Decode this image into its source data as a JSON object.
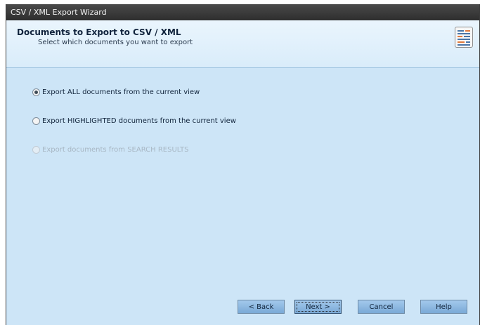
{
  "window": {
    "title": "CSV / XML Export Wizard"
  },
  "header": {
    "title": "Documents to Export to CSV / XML",
    "subtitle": "Select which documents you want to export",
    "icon": "export-document-icon"
  },
  "options": [
    {
      "label": "Export ALL documents from the current view",
      "selected": true,
      "enabled": true
    },
    {
      "label": "Export HIGHLIGHTED documents from the current view",
      "selected": false,
      "enabled": true
    },
    {
      "label": "Export documents from SEARCH RESULTS",
      "selected": false,
      "enabled": false
    }
  ],
  "buttons": {
    "back": "< Back",
    "next": "Next >",
    "cancel": "Cancel",
    "help": "Help"
  }
}
